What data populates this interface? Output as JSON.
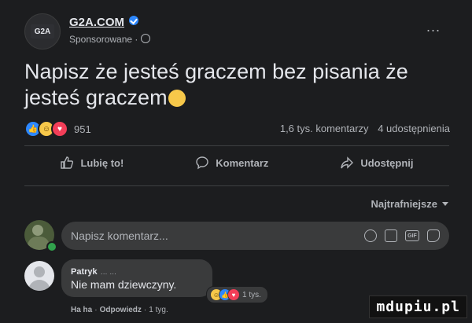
{
  "post": {
    "page_name": "G2A.COM",
    "logo_text": "G2A",
    "sponsored": "Sponsorowane ·",
    "more": "...",
    "text": "Napisz że jesteś graczem bez pisania że jesteś graczem",
    "reaction_count": "951",
    "comments_count": "1,6 tys. komentarzy",
    "shares_count": "4 udostępnienia"
  },
  "actions": {
    "like": "Lubię to!",
    "comment": "Komentarz",
    "share": "Udostępnij"
  },
  "comments": {
    "sort_label": "Najtrafniejsze",
    "composer_placeholder": "Napisz komentarz...",
    "gif_label": "GIF",
    "items": [
      {
        "author": "Patryk",
        "author_extra": "… …",
        "text": "Nie mam dziewczyny.",
        "reaction_count": "1 tys.",
        "reply_reaction": "Ha ha",
        "reply": "Odpowiedz",
        "time": "1 tyg."
      }
    ]
  },
  "watermark": "mdupiu.pl",
  "colors": {
    "background": "#1c1d1f",
    "like_blue": "#2d88ff",
    "love_red": "#f33e58",
    "haha_yellow": "#f7c84a"
  }
}
